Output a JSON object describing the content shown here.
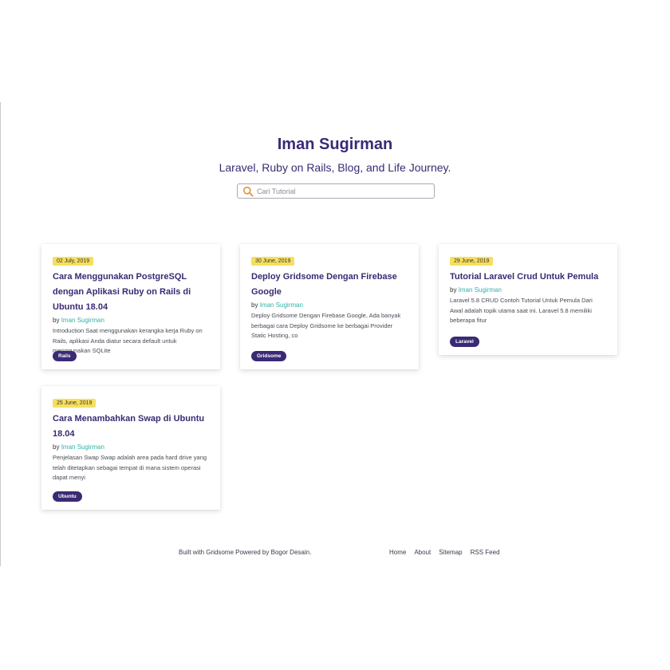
{
  "header": {
    "title": "Iman Sugirman",
    "tagline": "Laravel, Ruby on Rails, Blog, and Life Journey."
  },
  "search": {
    "placeholder": "Cari Tutorial",
    "icon": "search-icon"
  },
  "colors": {
    "brand": "#3a2a74",
    "date_badge": "#f6df5e",
    "author_link": "#2fb3a6"
  },
  "posts": [
    {
      "date": "02 July, 2019",
      "title": "Cara Menggunakan PostgreSQL dengan Aplikasi Ruby on Rails di Ubuntu 18.04",
      "by": "by",
      "author": "Iman Sugirman",
      "excerpt": "Introduction Saat menggunakan kerangka kerja Ruby on Rails, aplikasi Anda diatur secara default untuk menggunakan SQLite",
      "tag": "Rails"
    },
    {
      "date": "30 June, 2019",
      "title": "Deploy Gridsome Dengan Firebase Google",
      "by": "by",
      "author": "Iman Sugirman",
      "excerpt": "Deploy Gridsome Dengan Firebase Google, Ada banyak berbagai cara Deploy Gridsome ke berbagai Provider Static Hosting, co",
      "tag": "Gridsome"
    },
    {
      "date": "29 June, 2019",
      "title": "Tutorial Laravel Crud Untuk Pemula",
      "by": "by",
      "author": "Iman Sugirman",
      "excerpt": "Laravel 5.8 CRUD Contoh Tutorial Untuk Pemula Dari Awal adalah topik utama saat ini. Laravel 5.8 memiliki beberapa fitur",
      "tag": "Laravel"
    },
    {
      "date": "25 June, 2019",
      "title": "Cara Menambahkan Swap di Ubuntu 18.04",
      "by": "by",
      "author": "Iman Sugirman",
      "excerpt": "Penjelasan Swap Swap adalah area pada hard drive yang telah ditetapkan sebagai tempat di mana sistem operasi dapat menyi",
      "tag": "Ubuntu"
    }
  ],
  "footer": {
    "credit": "Built with Gridsome Powered by Bogor Desain.",
    "nav": [
      "Home",
      "About",
      "Sitemap",
      "RSS Feed"
    ]
  }
}
